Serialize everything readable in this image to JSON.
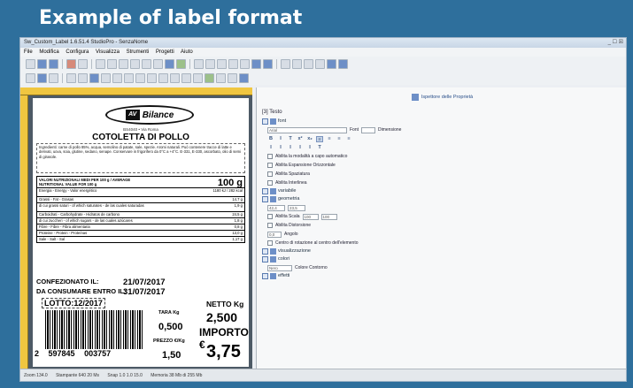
{
  "slide_title": "Example of label format",
  "window": {
    "title": "Sw_Custom_Label 1.6.51.4 StudioPro - SenzaNome",
    "controls": "_ ☐ ☒"
  },
  "menu": [
    "File",
    "Modifica",
    "Configura",
    "Visualizza",
    "Strumenti",
    "Progetti",
    "Aiuto"
  ],
  "label": {
    "brand": "Bilance",
    "brand_mark": "AV",
    "subtitle": "BS4040 • Via Roma",
    "product_name": "COTOLETTA DI POLLO",
    "ingredients": "Ingredienti: carne di pollo 85%, acqua, semolino di patate, sale, spezie. Aromi naturali. Può contenere tracce di latte e derivati, uova, soia, glutine, sedano, senape. Conservare in frigorifero da 0°C a +4°C. E-331, E-330, ascorbato, olio di semi di girasole.",
    "nutrition_title": "VALORI NUTRIZIONALI MEDI PER 100 g / AVERAGE NUTRITIONAL VALUE FOR 100 g",
    "nutrition_weight": "100 g",
    "nutrition_rows": [
      {
        "name": "Energia - Energy - Valor energético",
        "value": "1180 kJ / 282 kcal",
        "tall": true
      },
      {
        "name": "Grassi - Fat - Grasas",
        "value": "14,7 g",
        "tall": false
      },
      {
        "name": "di cui grassi saturi - of which saturates - de las cuales saturadas",
        "value": "1,9 g",
        "tall": true
      },
      {
        "name": "Carboidrati - Carbohydrate - Hidratos de carbono",
        "value": "24,5 g",
        "tall": false
      },
      {
        "name": "di cui zuccheri - of which sugars - de las cuales azúcares",
        "value": "1,8 g",
        "tall": false
      },
      {
        "name": "Fibre - Fibre - Fibra alimentaria",
        "value": "0,8 g",
        "tall": false
      },
      {
        "name": "Proteine - Protein - Proteínas",
        "value": "13,0 g",
        "tall": false
      },
      {
        "name": "Sale - Salt - Sal",
        "value": "1,17 g",
        "tall": false
      }
    ],
    "packed_label": "CONFEZIONATO IL:",
    "packed_date": "21/07/2017",
    "use_by_label": "DA CONSUMARE ENTRO IL:",
    "use_by_date": "31/07/2017",
    "lot": "LOTTO:12/2017",
    "tare_label": "TARA Kg",
    "tare_value": "0,500",
    "price_kg_label": "PREZZO €/Kg",
    "price_kg_value": "1,50",
    "net_label": "NETTO Kg",
    "net_value": "2,500",
    "amount_label": "IMPORTO €",
    "amount_value": "3,75",
    "barcode_digits": [
      "2",
      "597845",
      "003757"
    ]
  },
  "props": {
    "header": "Ispettore delle Proprietà",
    "section": "[3] Testo",
    "font_group": "font",
    "font_name": "Arial",
    "font_size_label": "Font",
    "font_dim_label": "Dimensione",
    "format_buttons": [
      "B",
      "I",
      "T",
      "x²",
      "x₂",
      "≡",
      "≡",
      "≡",
      "≡"
    ],
    "checks": [
      "Abilita la modalità a capo automatico",
      "Abilita Espansione Orizzontale",
      "Abilita Spaziatura",
      "Abilita Interlinea"
    ],
    "variabile": "variabile",
    "geometria": "geometria",
    "geom_x": "42,4",
    "geom_y": "23,5",
    "scale_label": "Abilita Scala",
    "scale_x": "100",
    "scale_y": "100",
    "distortion_label": "Abilita Distorsione",
    "angle_value": "0,0",
    "angle_label": "Angolo",
    "rotation_label": "Centro di rotazione al centro dell'elemento",
    "visualizzazione": "visualizzazione",
    "colori": "colori",
    "color_value": "Nero",
    "color_label": "Colore Contorno",
    "effetti": "effetti"
  },
  "status": {
    "zoom": "Zoom 134.0",
    "printer": "Stampante 640 20 Ms",
    "snap": "Snap 1.0 1.0 15.0",
    "memory": "Memoria 38 Mb di 255 Mb"
  },
  "colors": {
    "slide_bg": "#2e6f9c",
    "ruler": "#f0c640",
    "canvas_bg": "#4d5a66"
  }
}
